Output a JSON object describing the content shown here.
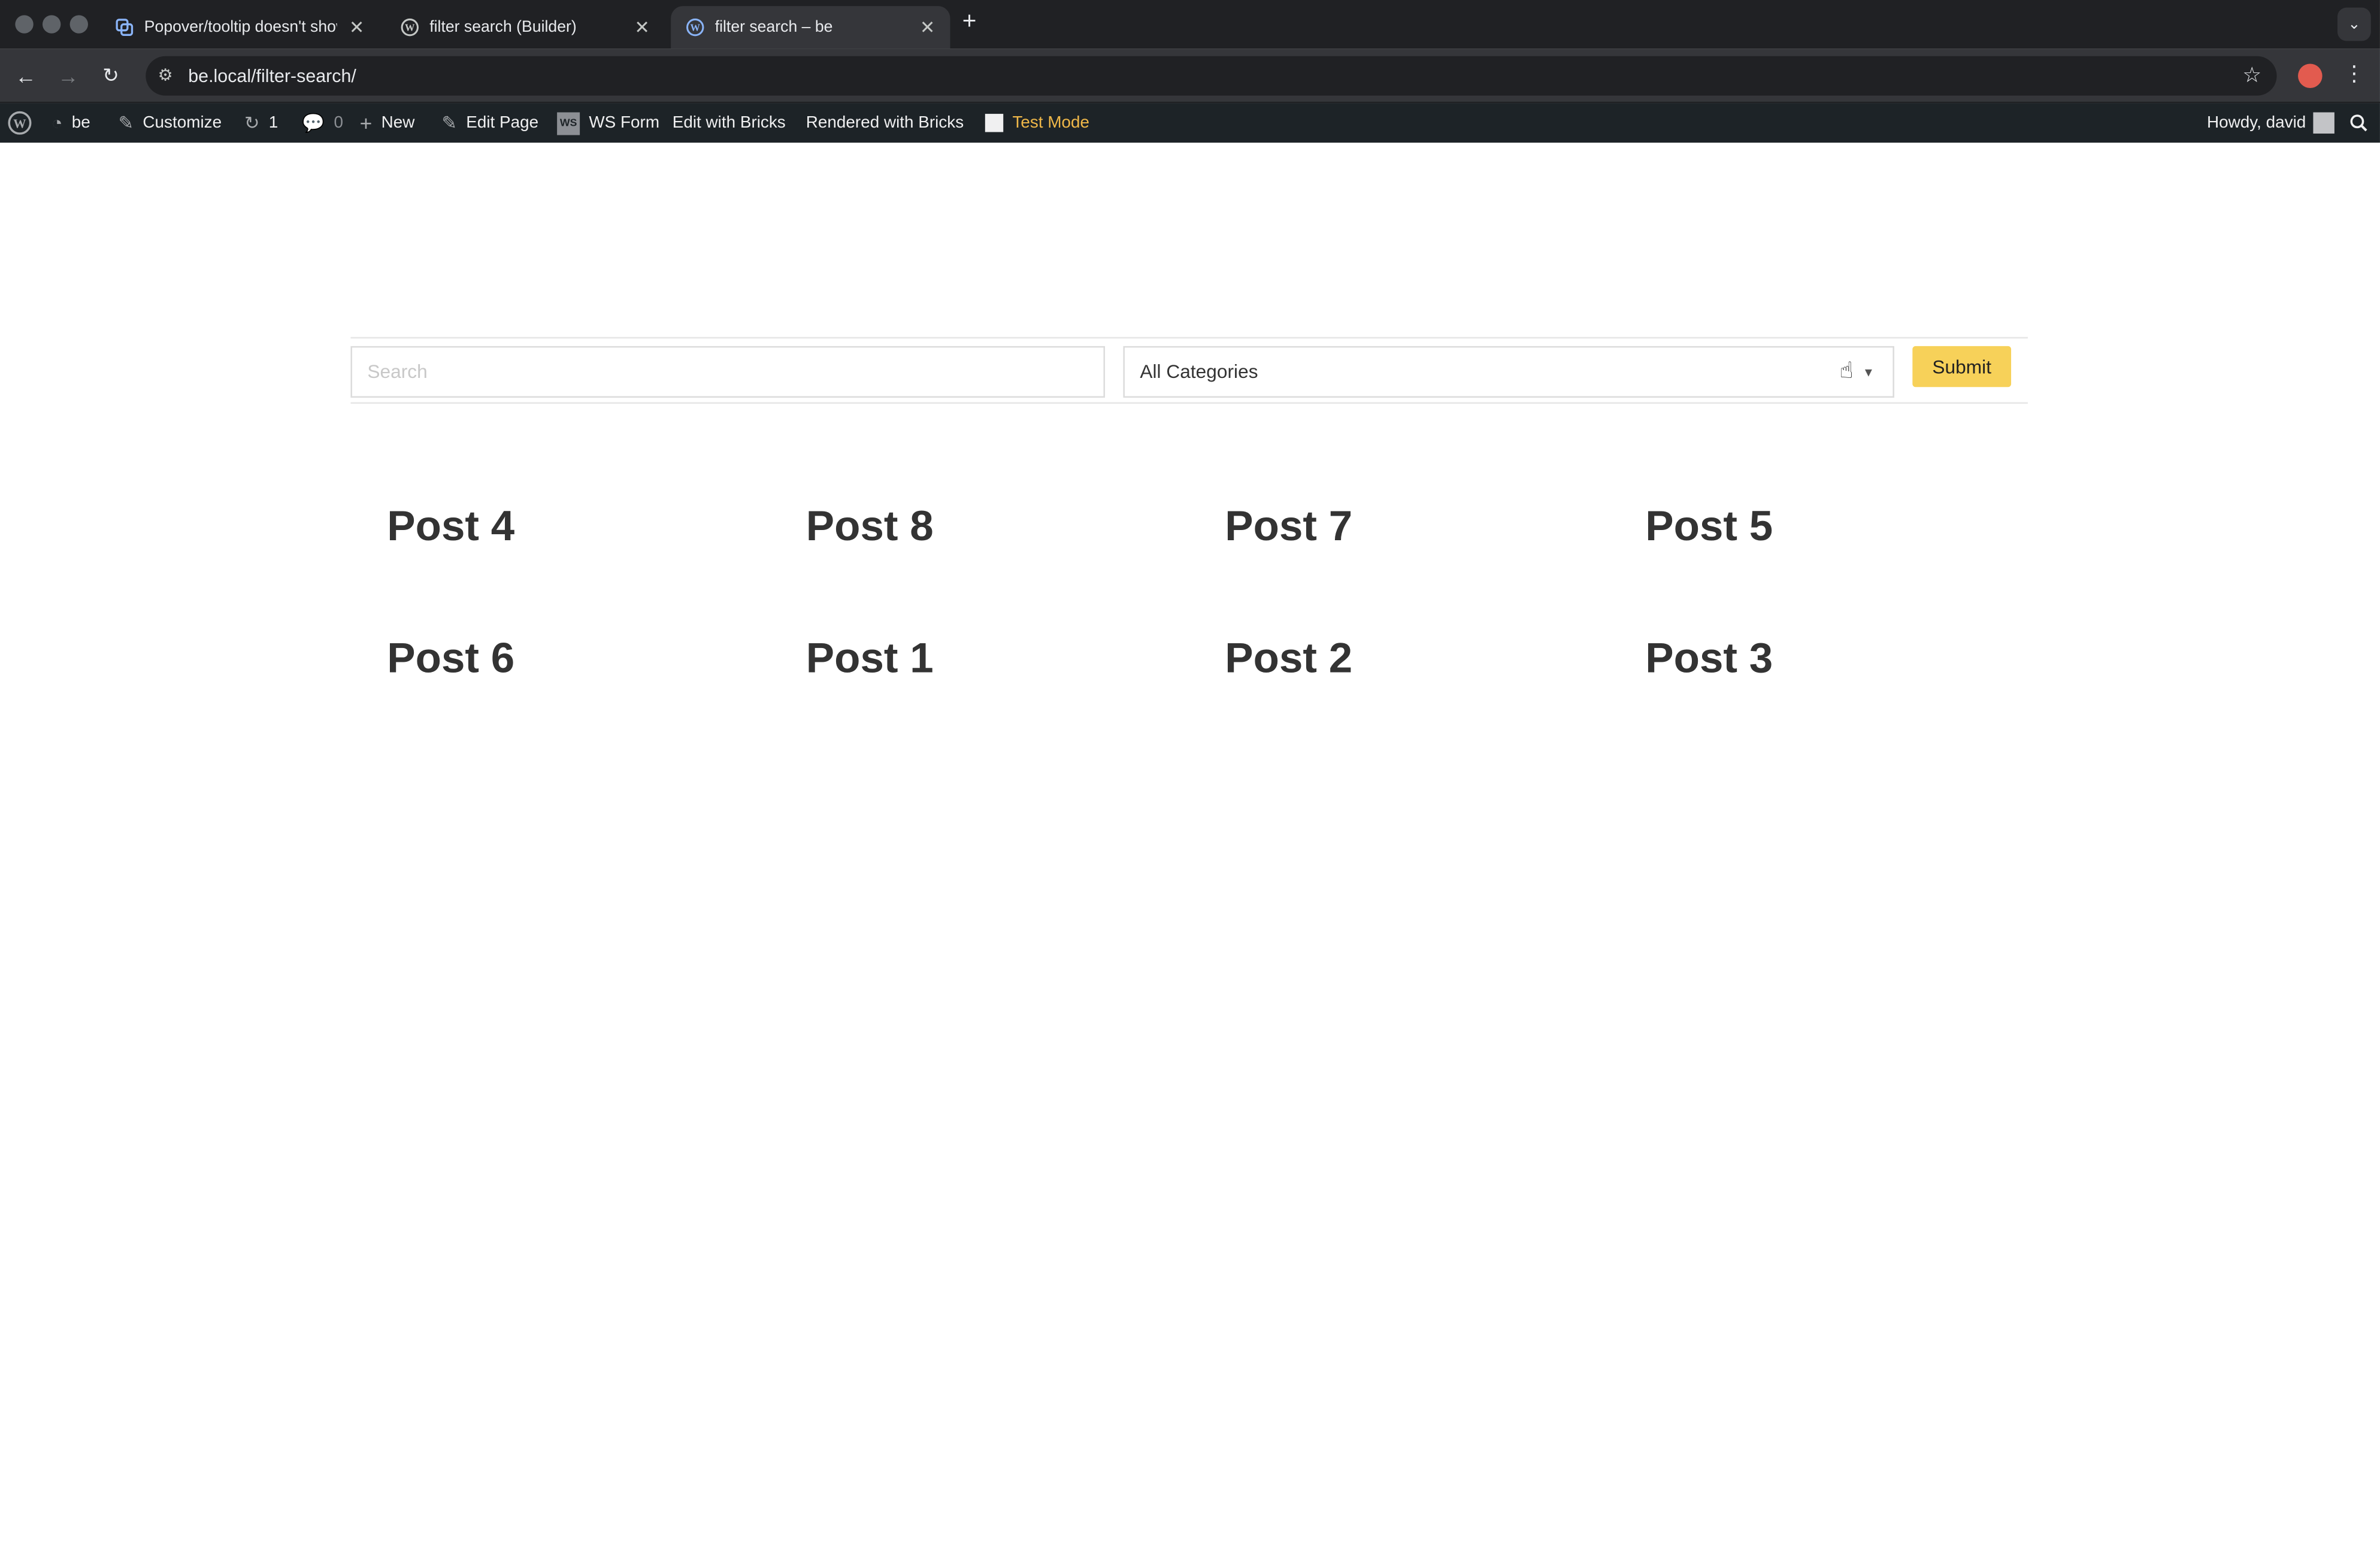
{
  "browser": {
    "tabs": [
      {
        "title": "Popover/tooltip doesn't show",
        "active": false
      },
      {
        "title": "filter search (Builder)",
        "active": false
      },
      {
        "title": "filter search – be",
        "active": true
      }
    ],
    "url": "be.local/filter-search/"
  },
  "admin_bar": {
    "site": "be",
    "customize": "Customize",
    "updates_count": "1",
    "comments_count": "0",
    "new": "New",
    "edit_page": "Edit Page",
    "ws_form_badge": "WS",
    "ws_form": "WS Form",
    "edit_with_bricks": "Edit with Bricks",
    "rendered_with_bricks": "Rendered with Bricks",
    "test_mode": "Test Mode",
    "howdy": "Howdy, david"
  },
  "filter": {
    "search_placeholder": "Search",
    "category_selected": "All Categories",
    "submit_label": "Submit"
  },
  "posts": [
    "Post 4",
    "Post 8",
    "Post 7",
    "Post 5",
    "Post 6",
    "Post 1",
    "Post 2",
    "Post 3"
  ],
  "colors": {
    "submit_bg": "#f7d159",
    "admin_bar_bg": "#1d2327",
    "test_mode": "#f0b849",
    "post_title": "#333333"
  }
}
